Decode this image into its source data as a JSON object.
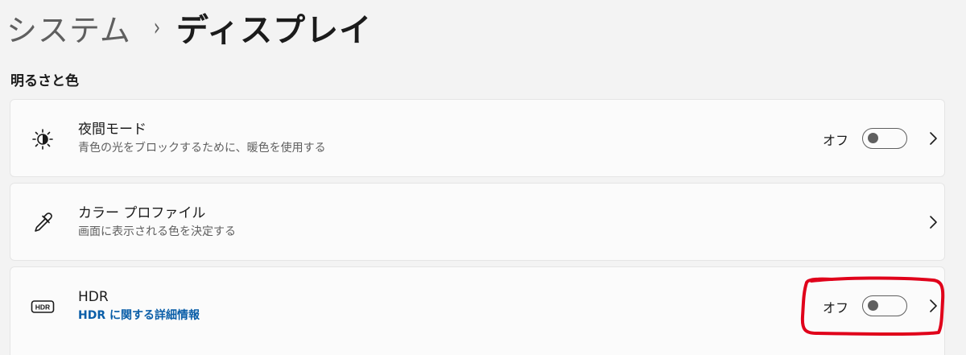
{
  "breadcrumb": {
    "parent": "システム",
    "separator": "›",
    "current": "ディスプレイ"
  },
  "section": {
    "title": "明るさと色"
  },
  "rows": [
    {
      "title": "夜間モード",
      "subtitle": "青色の光をブロックするために、暖色を使用する",
      "icon": "night-light-icon",
      "toggle_label": "オフ",
      "toggle_on": false
    },
    {
      "title": "カラー プロファイル",
      "subtitle": "画面に表示される色を決定する",
      "icon": "eyedropper-icon"
    },
    {
      "title": "HDR",
      "link": "HDR に関する詳細情報",
      "icon": "hdr-icon",
      "icon_text": "HDR",
      "toggle_label": "オフ",
      "toggle_on": false
    }
  ],
  "colors": {
    "background": "#f3f3f3",
    "card": "#fbfbfb",
    "link": "#0a5ea8",
    "annotation": "#e0001a"
  }
}
